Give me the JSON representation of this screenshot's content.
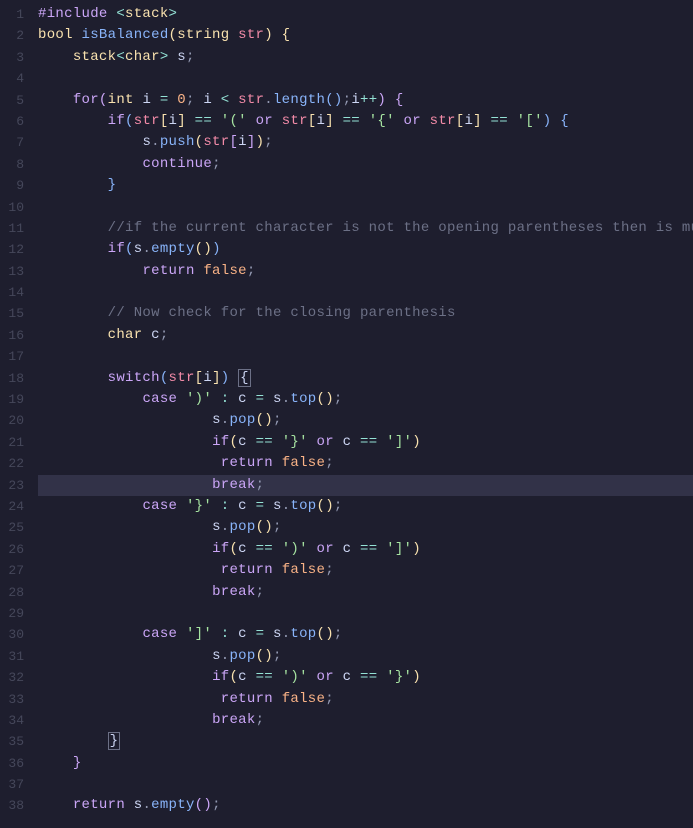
{
  "lines": [
    {
      "n": 1,
      "hl": false,
      "tokens": [
        [
          "kw",
          "#include "
        ],
        [
          "op",
          "<"
        ],
        [
          "ty",
          "stack"
        ],
        [
          "op",
          ">"
        ]
      ]
    },
    {
      "n": 2,
      "hl": false,
      "tokens": [
        [
          "ty",
          "bool "
        ],
        [
          "fn",
          "isBalanced"
        ],
        [
          "br1",
          "("
        ],
        [
          "ty",
          "string "
        ],
        [
          "pa",
          "str"
        ],
        [
          "br1",
          ") "
        ],
        [
          "br1",
          "{"
        ]
      ]
    },
    {
      "n": 3,
      "hl": false,
      "tokens": [
        [
          "id",
          "    "
        ],
        [
          "ty",
          "stack"
        ],
        [
          "op",
          "<"
        ],
        [
          "ty",
          "char"
        ],
        [
          "op",
          ">"
        ],
        [
          "id",
          " s"
        ],
        [
          "pu",
          ";"
        ]
      ]
    },
    {
      "n": 4,
      "hl": false,
      "tokens": [
        [
          "id",
          " "
        ]
      ]
    },
    {
      "n": 5,
      "hl": false,
      "tokens": [
        [
          "ig",
          "    "
        ],
        [
          "kw",
          "for"
        ],
        [
          "br2",
          "("
        ],
        [
          "ty",
          "int "
        ],
        [
          "id",
          "i "
        ],
        [
          "op",
          "= "
        ],
        [
          "nu",
          "0"
        ],
        [
          "pu",
          "; "
        ],
        [
          "id",
          "i "
        ],
        [
          "op",
          "< "
        ],
        [
          "pa",
          "str"
        ],
        [
          "pu",
          "."
        ],
        [
          "fn",
          "length"
        ],
        [
          "br3",
          "()"
        ],
        [
          "pu",
          ";"
        ],
        [
          "id",
          "i"
        ],
        [
          "op",
          "++"
        ],
        [
          "br2",
          ") "
        ],
        [
          "br2",
          "{"
        ]
      ]
    },
    {
      "n": 6,
      "hl": false,
      "tokens": [
        [
          "ig",
          "    "
        ],
        [
          "ig",
          "    "
        ],
        [
          "kw",
          "if"
        ],
        [
          "br3",
          "("
        ],
        [
          "pa",
          "str"
        ],
        [
          "br1",
          "["
        ],
        [
          "id",
          "i"
        ],
        [
          "br1",
          "]"
        ],
        [
          "op",
          " == "
        ],
        [
          "st",
          "'('"
        ],
        [
          "kw",
          " or "
        ],
        [
          "pa",
          "str"
        ],
        [
          "br1",
          "["
        ],
        [
          "id",
          "i"
        ],
        [
          "br1",
          "]"
        ],
        [
          "op",
          " == "
        ],
        [
          "st",
          "'{'"
        ],
        [
          "kw",
          " or "
        ],
        [
          "pa",
          "str"
        ],
        [
          "br1",
          "["
        ],
        [
          "id",
          "i"
        ],
        [
          "br1",
          "]"
        ],
        [
          "op",
          " == "
        ],
        [
          "st",
          "'['"
        ],
        [
          "br3",
          ") "
        ],
        [
          "br3",
          "{"
        ]
      ]
    },
    {
      "n": 7,
      "hl": false,
      "tokens": [
        [
          "ig",
          "    "
        ],
        [
          "ig",
          "    "
        ],
        [
          "ig",
          "    "
        ],
        [
          "id",
          "s"
        ],
        [
          "pu",
          "."
        ],
        [
          "fn",
          "push"
        ],
        [
          "br1",
          "("
        ],
        [
          "pa",
          "str"
        ],
        [
          "br2",
          "["
        ],
        [
          "id",
          "i"
        ],
        [
          "br2",
          "]"
        ],
        [
          "br1",
          ")"
        ],
        [
          "pu",
          ";"
        ]
      ]
    },
    {
      "n": 8,
      "hl": false,
      "tokens": [
        [
          "ig",
          "    "
        ],
        [
          "ig",
          "    "
        ],
        [
          "ig",
          "    "
        ],
        [
          "kw",
          "continue"
        ],
        [
          "pu",
          ";"
        ]
      ]
    },
    {
      "n": 9,
      "hl": false,
      "tokens": [
        [
          "ig",
          "    "
        ],
        [
          "ig",
          "    "
        ],
        [
          "br3",
          "}"
        ]
      ]
    },
    {
      "n": 10,
      "hl": false,
      "tokens": [
        [
          "id",
          " "
        ]
      ]
    },
    {
      "n": 11,
      "hl": false,
      "tokens": [
        [
          "ig",
          "    "
        ],
        [
          "ig",
          "    "
        ],
        [
          "cm",
          "//if the current character is not the opening parentheses then is mu"
        ]
      ]
    },
    {
      "n": 12,
      "hl": false,
      "tokens": [
        [
          "ig",
          "    "
        ],
        [
          "ig",
          "    "
        ],
        [
          "kw",
          "if"
        ],
        [
          "br3",
          "("
        ],
        [
          "id",
          "s"
        ],
        [
          "pu",
          "."
        ],
        [
          "fn",
          "empty"
        ],
        [
          "br1",
          "()"
        ],
        [
          "br3",
          ")"
        ]
      ]
    },
    {
      "n": 13,
      "hl": false,
      "tokens": [
        [
          "ig",
          "    "
        ],
        [
          "ig",
          "    "
        ],
        [
          "ig",
          "    "
        ],
        [
          "kw",
          "return "
        ],
        [
          "nu",
          "false"
        ],
        [
          "pu",
          ";"
        ]
      ]
    },
    {
      "n": 14,
      "hl": false,
      "tokens": [
        [
          "id",
          " "
        ]
      ]
    },
    {
      "n": 15,
      "hl": false,
      "tokens": [
        [
          "ig",
          "    "
        ],
        [
          "ig",
          "    "
        ],
        [
          "cm",
          "// Now check for the closing parenthesis"
        ]
      ]
    },
    {
      "n": 16,
      "hl": false,
      "tokens": [
        [
          "ig",
          "    "
        ],
        [
          "ig",
          "    "
        ],
        [
          "ty",
          "char "
        ],
        [
          "id",
          "c"
        ],
        [
          "pu",
          ";"
        ]
      ]
    },
    {
      "n": 17,
      "hl": false,
      "tokens": [
        [
          "id",
          " "
        ]
      ]
    },
    {
      "n": 18,
      "hl": false,
      "tokens": [
        [
          "ig",
          "    "
        ],
        [
          "ig",
          "    "
        ],
        [
          "kw",
          "switch"
        ],
        [
          "br3",
          "("
        ],
        [
          "pa",
          "str"
        ],
        [
          "br1",
          "["
        ],
        [
          "id",
          "i"
        ],
        [
          "br1",
          "]"
        ],
        [
          "br3",
          ") "
        ],
        [
          "box",
          "{"
        ]
      ]
    },
    {
      "n": 19,
      "hl": false,
      "tokens": [
        [
          "ig",
          "    "
        ],
        [
          "ig",
          "    "
        ],
        [
          "ig",
          "    "
        ],
        [
          "kw",
          "case "
        ],
        [
          "st",
          "')'"
        ],
        [
          "op",
          " : "
        ],
        [
          "id",
          "c "
        ],
        [
          "op",
          "= "
        ],
        [
          "id",
          "s"
        ],
        [
          "pu",
          "."
        ],
        [
          "fn",
          "top"
        ],
        [
          "br1",
          "()"
        ],
        [
          "pu",
          ";"
        ]
      ]
    },
    {
      "n": 20,
      "hl": false,
      "tokens": [
        [
          "ig",
          "    "
        ],
        [
          "ig",
          "    "
        ],
        [
          "ig",
          "    "
        ],
        [
          "ig",
          "    "
        ],
        [
          "ig",
          "    "
        ],
        [
          "id",
          "s"
        ],
        [
          "pu",
          "."
        ],
        [
          "fn",
          "pop"
        ],
        [
          "br1",
          "()"
        ],
        [
          "pu",
          ";"
        ]
      ]
    },
    {
      "n": 21,
      "hl": false,
      "tokens": [
        [
          "ig",
          "    "
        ],
        [
          "ig",
          "    "
        ],
        [
          "ig",
          "    "
        ],
        [
          "ig",
          "    "
        ],
        [
          "ig",
          "    "
        ],
        [
          "kw",
          "if"
        ],
        [
          "br1",
          "("
        ],
        [
          "id",
          "c "
        ],
        [
          "op",
          "== "
        ],
        [
          "st",
          "'}'"
        ],
        [
          "kw",
          " or "
        ],
        [
          "id",
          "c "
        ],
        [
          "op",
          "== "
        ],
        [
          "st",
          "']'"
        ],
        [
          "br1",
          ")"
        ]
      ]
    },
    {
      "n": 22,
      "hl": false,
      "tokens": [
        [
          "ig",
          "    "
        ],
        [
          "ig",
          "    "
        ],
        [
          "ig",
          "    "
        ],
        [
          "ig",
          "    "
        ],
        [
          "ig",
          "    "
        ],
        [
          "ig",
          " "
        ],
        [
          "kw",
          "return "
        ],
        [
          "nu",
          "false"
        ],
        [
          "pu",
          ";"
        ]
      ]
    },
    {
      "n": 23,
      "hl": true,
      "tokens": [
        [
          "ig",
          "    "
        ],
        [
          "ig",
          "    "
        ],
        [
          "ig",
          "    "
        ],
        [
          "ig",
          "    "
        ],
        [
          "ig",
          "    "
        ],
        [
          "kw",
          "break"
        ],
        [
          "pu",
          ";"
        ]
      ]
    },
    {
      "n": 24,
      "hl": false,
      "tokens": [
        [
          "ig",
          "    "
        ],
        [
          "ig",
          "    "
        ],
        [
          "ig",
          "    "
        ],
        [
          "kw",
          "case "
        ],
        [
          "st",
          "'}'"
        ],
        [
          "op",
          " : "
        ],
        [
          "id",
          "c "
        ],
        [
          "op",
          "= "
        ],
        [
          "id",
          "s"
        ],
        [
          "pu",
          "."
        ],
        [
          "fn",
          "top"
        ],
        [
          "br1",
          "()"
        ],
        [
          "pu",
          ";"
        ]
      ]
    },
    {
      "n": 25,
      "hl": false,
      "tokens": [
        [
          "ig",
          "    "
        ],
        [
          "ig",
          "    "
        ],
        [
          "ig",
          "    "
        ],
        [
          "ig",
          "    "
        ],
        [
          "ig",
          "    "
        ],
        [
          "id",
          "s"
        ],
        [
          "pu",
          "."
        ],
        [
          "fn",
          "pop"
        ],
        [
          "br1",
          "()"
        ],
        [
          "pu",
          ";"
        ]
      ]
    },
    {
      "n": 26,
      "hl": false,
      "tokens": [
        [
          "ig",
          "    "
        ],
        [
          "ig",
          "    "
        ],
        [
          "ig",
          "    "
        ],
        [
          "ig",
          "    "
        ],
        [
          "ig",
          "    "
        ],
        [
          "kw",
          "if"
        ],
        [
          "br1",
          "("
        ],
        [
          "id",
          "c "
        ],
        [
          "op",
          "== "
        ],
        [
          "st",
          "')'"
        ],
        [
          "kw",
          " or "
        ],
        [
          "id",
          "c "
        ],
        [
          "op",
          "== "
        ],
        [
          "st",
          "']'"
        ],
        [
          "br1",
          ")"
        ]
      ]
    },
    {
      "n": 27,
      "hl": false,
      "tokens": [
        [
          "ig",
          "    "
        ],
        [
          "ig",
          "    "
        ],
        [
          "ig",
          "    "
        ],
        [
          "ig",
          "    "
        ],
        [
          "ig",
          "    "
        ],
        [
          "ig",
          " "
        ],
        [
          "kw",
          "return "
        ],
        [
          "nu",
          "false"
        ],
        [
          "pu",
          ";"
        ]
      ]
    },
    {
      "n": 28,
      "hl": false,
      "tokens": [
        [
          "ig",
          "    "
        ],
        [
          "ig",
          "    "
        ],
        [
          "ig",
          "    "
        ],
        [
          "ig",
          "    "
        ],
        [
          "ig",
          "    "
        ],
        [
          "kw",
          "break"
        ],
        [
          "pu",
          ";"
        ]
      ]
    },
    {
      "n": 29,
      "hl": false,
      "tokens": [
        [
          "id",
          " "
        ]
      ]
    },
    {
      "n": 30,
      "hl": false,
      "tokens": [
        [
          "ig",
          "    "
        ],
        [
          "ig",
          "    "
        ],
        [
          "ig",
          "    "
        ],
        [
          "kw",
          "case "
        ],
        [
          "st",
          "']'"
        ],
        [
          "op",
          " : "
        ],
        [
          "id",
          "c "
        ],
        [
          "op",
          "= "
        ],
        [
          "id",
          "s"
        ],
        [
          "pu",
          "."
        ],
        [
          "fn",
          "top"
        ],
        [
          "br1",
          "()"
        ],
        [
          "pu",
          ";"
        ]
      ]
    },
    {
      "n": 31,
      "hl": false,
      "tokens": [
        [
          "ig",
          "    "
        ],
        [
          "ig",
          "    "
        ],
        [
          "ig",
          "    "
        ],
        [
          "ig",
          "    "
        ],
        [
          "ig",
          "    "
        ],
        [
          "id",
          "s"
        ],
        [
          "pu",
          "."
        ],
        [
          "fn",
          "pop"
        ],
        [
          "br1",
          "()"
        ],
        [
          "pu",
          ";"
        ]
      ]
    },
    {
      "n": 32,
      "hl": false,
      "tokens": [
        [
          "ig",
          "    "
        ],
        [
          "ig",
          "    "
        ],
        [
          "ig",
          "    "
        ],
        [
          "ig",
          "    "
        ],
        [
          "ig",
          "    "
        ],
        [
          "kw",
          "if"
        ],
        [
          "br1",
          "("
        ],
        [
          "id",
          "c "
        ],
        [
          "op",
          "== "
        ],
        [
          "st",
          "')'"
        ],
        [
          "kw",
          " or "
        ],
        [
          "id",
          "c "
        ],
        [
          "op",
          "== "
        ],
        [
          "st",
          "'}'"
        ],
        [
          "br1",
          ")"
        ]
      ]
    },
    {
      "n": 33,
      "hl": false,
      "tokens": [
        [
          "ig",
          "    "
        ],
        [
          "ig",
          "    "
        ],
        [
          "ig",
          "    "
        ],
        [
          "ig",
          "    "
        ],
        [
          "ig",
          "    "
        ],
        [
          "ig",
          " "
        ],
        [
          "kw",
          "return "
        ],
        [
          "nu",
          "false"
        ],
        [
          "pu",
          ";"
        ]
      ]
    },
    {
      "n": 34,
      "hl": false,
      "tokens": [
        [
          "ig",
          "    "
        ],
        [
          "ig",
          "    "
        ],
        [
          "ig",
          "    "
        ],
        [
          "ig",
          "    "
        ],
        [
          "ig",
          "    "
        ],
        [
          "kw",
          "break"
        ],
        [
          "pu",
          ";"
        ]
      ]
    },
    {
      "n": 35,
      "hl": false,
      "tokens": [
        [
          "ig",
          "    "
        ],
        [
          "ig",
          "    "
        ],
        [
          "box",
          "}"
        ]
      ]
    },
    {
      "n": 36,
      "hl": false,
      "tokens": [
        [
          "ig",
          "    "
        ],
        [
          "br2",
          "}"
        ]
      ]
    },
    {
      "n": 37,
      "hl": false,
      "tokens": [
        [
          "id",
          " "
        ]
      ]
    },
    {
      "n": 38,
      "hl": false,
      "tokens": [
        [
          "ig",
          "    "
        ],
        [
          "kw",
          "return "
        ],
        [
          "id",
          "s"
        ],
        [
          "pu",
          "."
        ],
        [
          "fn",
          "empty"
        ],
        [
          "br2",
          "()"
        ],
        [
          "pu",
          ";"
        ]
      ]
    }
  ]
}
